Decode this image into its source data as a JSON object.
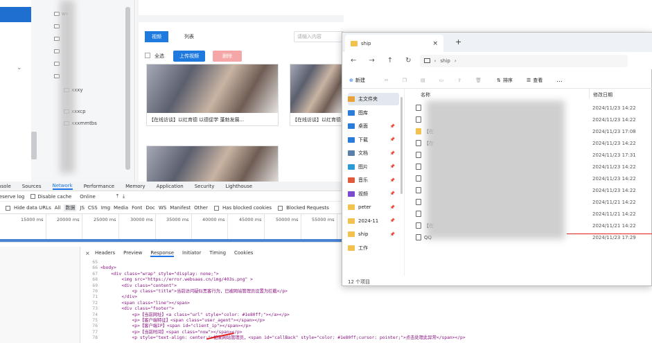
{
  "left_tree": {
    "items": [
      "ws",
      "",
      "",
      "",
      "",
      "",
      "xxxy",
      "xxxcp",
      "xxxmmtbs"
    ]
  },
  "webpage": {
    "header_tabs": [
      "视频",
      "列表"
    ],
    "search_placeholder": "请输入内容",
    "select_all_label": "全选",
    "upload_button": "上传视频",
    "delete_button": "删除",
    "video_captions": [
      "【在线访谈】以红育德 以德促学 蓬勃发展...",
      "【在线访谈】以红育德"
    ]
  },
  "devtools": {
    "tabs": [
      "Console",
      "Sources",
      "Network",
      "Performance",
      "Memory",
      "Application",
      "Security",
      "Lighthouse"
    ],
    "active_tab": "Network",
    "toolbar": {
      "preserve_log": "Preserve log",
      "disable_cache": "Disable cache",
      "throttle": "Online"
    },
    "filters": [
      "Hide data URLs",
      "All",
      "Fetch/XHR",
      "JS",
      "CSS",
      "Img",
      "Media",
      "Font",
      "Doc",
      "WS",
      "Manifest",
      "Other",
      "Has blocked cookies",
      "Blocked Requests"
    ],
    "filters_display": [
      "Hide data URLs",
      "All",
      "数据",
      "JS",
      "CSS",
      "Img",
      "Media",
      "Font",
      "Doc",
      "WS",
      "Manifest",
      "Other"
    ],
    "timeline_ticks": [
      "15000 ms",
      "20000 ms",
      "25000 ms",
      "30000 ms",
      "35000 ms",
      "40000 ms",
      "45000 ms",
      "50000 ms",
      "55000 ms"
    ],
    "detail_tabs": [
      "Headers",
      "Preview",
      "Response",
      "Initiator",
      "Timing",
      "Cookies"
    ],
    "active_detail_tab": "Response",
    "code_lines": [
      {
        "n": "65",
        "t": ""
      },
      {
        "n": "66",
        "t": "<body>"
      },
      {
        "n": "67",
        "t": "    <div class=\"wrap\" style=\"display: none;\">"
      },
      {
        "n": "68",
        "t": "        <img src=\"https://error.websaas.cn/img/403s.png\" >"
      },
      {
        "n": "69",
        "t": "        <div class=\"content\">"
      },
      {
        "n": "70",
        "t": "            <p class=\"title\">当前访问疑似黑客行为，已被网站管理员设置为拦截</p>"
      },
      {
        "n": "71",
        "t": "        </div>"
      },
      {
        "n": "72",
        "t": "        <span class=\"line\"></span>"
      },
      {
        "n": "73",
        "t": "        <div class=\"footer\">"
      },
      {
        "n": "74",
        "t": "            <p>【当前网址】<a class=\"url\" style=\"color: #1e80ff;\"></a></p>"
      },
      {
        "n": "75",
        "t": "            <p>【客户端特征】<span class=\"user_agent\"></span></p>"
      },
      {
        "n": "76",
        "t": "            <p>【客户端IP】<span id=\"client_ip\"></span></p>"
      },
      {
        "n": "77",
        "t": "            <p>【当前时间】<span class=\"now\"></span></p>"
      },
      {
        "n": "78",
        "t": "            <p style=\"text-align: center;\">如果网站管理员，<span id=\"callBack\" style=\"color: #1e80ff;cursor: pointer;\">点击处理此异常</span></p>"
      }
    ]
  },
  "explorer": {
    "title": "ship",
    "breadcrumb": [
      "ship"
    ],
    "toolbar": {
      "new": "新建",
      "sort": "排序",
      "view": "查看",
      "more": "..."
    },
    "sidebar": [
      {
        "label": "主文件夹",
        "icon": "home-icon",
        "color": "#e8a33b"
      },
      {
        "label": "图库",
        "icon": "gallery-icon",
        "color": "#2b7bd8"
      },
      {
        "label": "桌面",
        "icon": "desktop-icon",
        "color": "#2b7bd8"
      },
      {
        "label": "下载",
        "icon": "download-icon",
        "color": "#2b7bd8"
      },
      {
        "label": "文档",
        "icon": "document-icon",
        "color": "#5a7fa8"
      },
      {
        "label": "图片",
        "icon": "picture-icon",
        "color": "#2b9bd8"
      },
      {
        "label": "音乐",
        "icon": "music-icon",
        "color": "#e05b3a"
      },
      {
        "label": "视频",
        "icon": "video-icon",
        "color": "#7a4bd1"
      },
      {
        "label": "peter",
        "icon": "folder-icon",
        "color": "#f2c14e"
      },
      {
        "label": "2024-11",
        "icon": "folder-icon",
        "color": "#f2c14e"
      },
      {
        "label": "ship",
        "icon": "folder-icon",
        "color": "#f2c14e"
      },
      {
        "label": "工作",
        "icon": "folder-icon",
        "color": "#f2c14e"
      }
    ],
    "columns": {
      "name": "名称",
      "date": "修改日期"
    },
    "files": [
      {
        "name": "",
        "date": "2024/11/23 14:22"
      },
      {
        "name": "",
        "date": "2024/11/23 14:22"
      },
      {
        "name": "【在",
        "date": "2024/11/23 17:08"
      },
      {
        "name": "【在",
        "date": "2024/11/23 14:22"
      },
      {
        "name": "",
        "date": "2024/11/23 17:31"
      },
      {
        "name": "",
        "date": "2024/11/23 14:22"
      },
      {
        "name": "",
        "date": "2024/11/23 14:22"
      },
      {
        "name": "",
        "date": "2024/11/23 14:22"
      },
      {
        "name": "",
        "date": "2024/11/21 14:22"
      },
      {
        "name": "",
        "date": "2024/11/21 14:22"
      },
      {
        "name": "【在",
        "date": "2024/11/21 14:22"
      },
      {
        "name": "QQ",
        "date": "2024/11/23 17:29"
      }
    ],
    "status": "12 个项目"
  }
}
